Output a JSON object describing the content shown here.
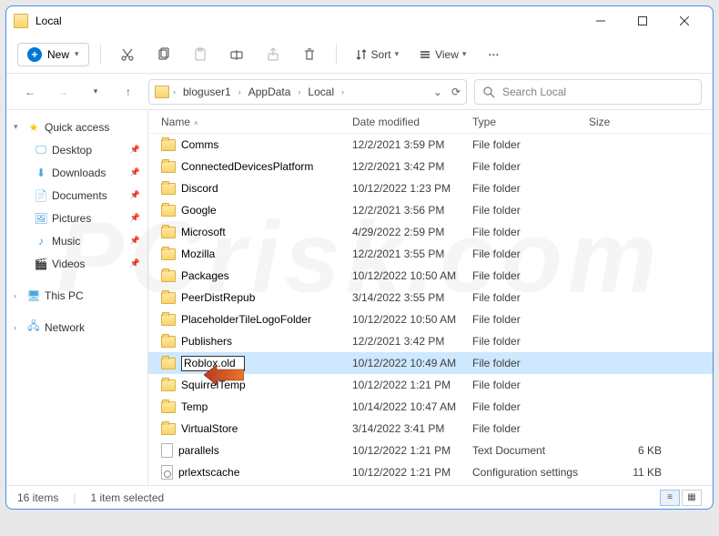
{
  "window": {
    "title": "Local"
  },
  "toolbar": {
    "new_label": "New",
    "sort_label": "Sort",
    "view_label": "View"
  },
  "breadcrumb": [
    "bloguser1",
    "AppData",
    "Local"
  ],
  "search": {
    "placeholder": "Search Local"
  },
  "sidebar": {
    "quick": "Quick access",
    "items": [
      "Desktop",
      "Downloads",
      "Documents",
      "Pictures",
      "Music",
      "Videos"
    ],
    "this_pc": "This PC",
    "network": "Network"
  },
  "columns": {
    "name": "Name",
    "date": "Date modified",
    "type": "Type",
    "size": "Size"
  },
  "files": [
    {
      "name": "Comms",
      "date": "12/2/2021 3:59 PM",
      "type": "File folder",
      "size": "",
      "kind": "folder"
    },
    {
      "name": "ConnectedDevicesPlatform",
      "date": "12/2/2021 3:42 PM",
      "type": "File folder",
      "size": "",
      "kind": "folder"
    },
    {
      "name": "Discord",
      "date": "10/12/2022 1:23 PM",
      "type": "File folder",
      "size": "",
      "kind": "folder"
    },
    {
      "name": "Google",
      "date": "12/2/2021 3:56 PM",
      "type": "File folder",
      "size": "",
      "kind": "folder"
    },
    {
      "name": "Microsoft",
      "date": "4/29/2022 2:59 PM",
      "type": "File folder",
      "size": "",
      "kind": "folder"
    },
    {
      "name": "Mozilla",
      "date": "12/2/2021 3:55 PM",
      "type": "File folder",
      "size": "",
      "kind": "folder"
    },
    {
      "name": "Packages",
      "date": "10/12/2022 10:50 AM",
      "type": "File folder",
      "size": "",
      "kind": "folder"
    },
    {
      "name": "PeerDistRepub",
      "date": "3/14/2022 3:55 PM",
      "type": "File folder",
      "size": "",
      "kind": "folder"
    },
    {
      "name": "PlaceholderTileLogoFolder",
      "date": "10/12/2022 10:50 AM",
      "type": "File folder",
      "size": "",
      "kind": "folder"
    },
    {
      "name": "Publishers",
      "date": "12/2/2021 3:42 PM",
      "type": "File folder",
      "size": "",
      "kind": "folder"
    },
    {
      "name": "Roblox.old",
      "date": "10/12/2022 10:49 AM",
      "type": "File folder",
      "size": "",
      "kind": "folder",
      "selected": true,
      "rename": true
    },
    {
      "name": "SquirrelTemp",
      "date": "10/12/2022 1:21 PM",
      "type": "File folder",
      "size": "",
      "kind": "folder"
    },
    {
      "name": "Temp",
      "date": "10/14/2022 10:47 AM",
      "type": "File folder",
      "size": "",
      "kind": "folder"
    },
    {
      "name": "VirtualStore",
      "date": "3/14/2022 3:41 PM",
      "type": "File folder",
      "size": "",
      "kind": "folder"
    },
    {
      "name": "parallels",
      "date": "10/12/2022 1:21 PM",
      "type": "Text Document",
      "size": "6 KB",
      "kind": "file"
    },
    {
      "name": "prlextscache",
      "date": "10/12/2022 1:21 PM",
      "type": "Configuration settings",
      "size": "11 KB",
      "kind": "cfg"
    }
  ],
  "status": {
    "count": "16 items",
    "selected": "1 item selected"
  },
  "watermark": "PCrisk.com"
}
